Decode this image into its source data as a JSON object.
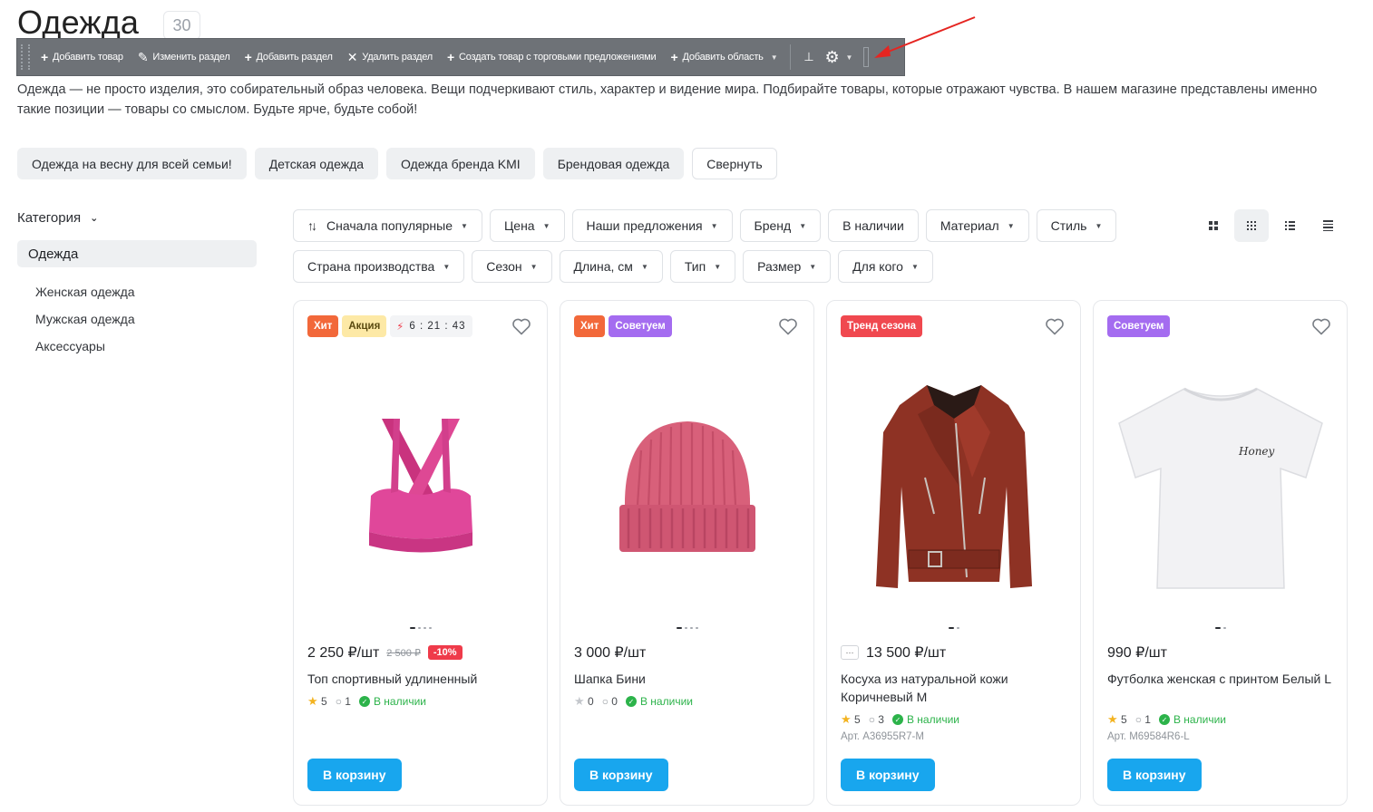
{
  "page": {
    "title": "Одежда",
    "count": "30",
    "description": "Одежда — не просто изделия, это собирательный образ человека. Вещи подчеркивают стиль, характер и видение мира. Подбирайте товары, которые отражают чувства. В нашем магазине представлены именно такие позиции — товары со смыслом. Будьте ярче, будьте собой!"
  },
  "toolbar": {
    "add_product": "Добавить товар",
    "edit_section": "Изменить раздел",
    "add_section": "Добавить раздел",
    "delete_section": "Удалить раздел",
    "create_offer_product": "Создать товар с торговыми предложениями",
    "add_area": "Добавить область"
  },
  "chips": [
    "Одежда на весну для всей семьи!",
    "Детская одежда",
    "Одежда бренда KMI",
    "Брендовая одежда",
    "Свернуть"
  ],
  "sidebar": {
    "heading": "Категория",
    "active": "Одежда",
    "items": [
      "Женская одежда",
      "Мужская одежда",
      "Аксессуары"
    ]
  },
  "filters": {
    "sort": "Сначала популярные",
    "items": [
      "Цена",
      "Наши предложения",
      "Бренд",
      "В наличии",
      "Материал",
      "Стиль",
      "Страна производства",
      "Сезон",
      "Длина, см",
      "Тип",
      "Размер",
      "Для кого"
    ]
  },
  "products": [
    {
      "badges": [
        "Хит",
        "Акция"
      ],
      "timer": "6 : 21 : 43",
      "price": "2 250 ₽/шт",
      "old_price": "2 500 ₽",
      "discount": "-10%",
      "name": "Топ спортивный удлиненный",
      "rating": "5",
      "comments": "1",
      "stock": "В наличии",
      "cart": "В корзину"
    },
    {
      "badges": [
        "Хит",
        "Советуем"
      ],
      "price": "3 000 ₽/шт",
      "name": "Шапка Бини",
      "rating": "0",
      "comments": "0",
      "stock": "В наличии",
      "cart": "В корзину"
    },
    {
      "badges": [
        "Тренд сезона"
      ],
      "offers_icon": "···",
      "price": "13 500 ₽/шт",
      "name": "Косуха из натуральной кожи Коричневый M",
      "rating": "5",
      "comments": "3",
      "stock": "В наличии",
      "article": "Арт. A36955R7-M",
      "cart": "В корзину"
    },
    {
      "badges": [
        "Советуем"
      ],
      "price": "990 ₽/шт",
      "name": "Футболка женская с принтом Белый L",
      "print_text": "Honey",
      "rating": "5",
      "comments": "1",
      "stock": "В наличии",
      "article": "Арт. M69584R6-L",
      "cart": "В корзину"
    }
  ],
  "colors": {
    "accent": "#18a6ee",
    "hit": "#f2683a",
    "advise": "#a46cf0",
    "trend": "#f0484f",
    "in_stock": "#2cb34a",
    "discount": "#ef3b4a"
  }
}
